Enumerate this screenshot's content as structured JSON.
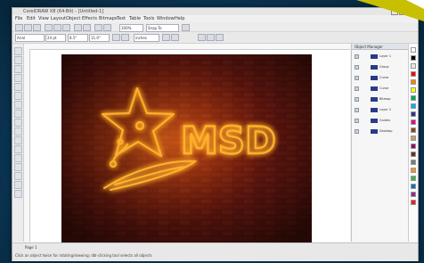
{
  "app": {
    "title": "CorelDRAW X8 (64-Bit) - [Untitled-1]",
    "menu": [
      "File",
      "Edit",
      "View",
      "Layout",
      "Object",
      "Effects",
      "Bitmaps",
      "Text",
      "Table",
      "Tools",
      "Window",
      "Help"
    ]
  },
  "toolbar": {
    "font_name": "Arial",
    "font_size": "24 pt",
    "zoom": "100%",
    "snap_to": "Snap To",
    "width_field": "8.5\"",
    "height_field": "11.0\"",
    "units": "inches"
  },
  "artwork": {
    "logo_text": "MSD",
    "description_colors": {
      "wall": "#8a1e16",
      "mortar": "#3b0805",
      "neon": "#ff9b12",
      "glow": "#ffcf66"
    }
  },
  "docker": {
    "title": "Object Manager",
    "layers": [
      {
        "label": "Layer 1"
      },
      {
        "label": "Group"
      },
      {
        "label": "Curve"
      },
      {
        "label": "Curve"
      },
      {
        "label": "Bitmap"
      },
      {
        "label": "Layer 2"
      },
      {
        "label": "Guides"
      },
      {
        "label": "Desktop"
      }
    ]
  },
  "palette": {
    "swatches": [
      "#ffffff",
      "#000000",
      "#e8e8e8",
      "#ff0000",
      "#ff7f00",
      "#ffff00",
      "#00a651",
      "#00aeef",
      "#2e3192",
      "#ec008c",
      "#8b4513",
      "#c69c6d",
      "#9e005d",
      "#603913",
      "#7a7a7a",
      "#f7941d",
      "#39b54a",
      "#0072bc",
      "#92278f",
      "#ed1c24"
    ]
  },
  "status": {
    "page": "Page 1",
    "info": "Click an object twice for rotating/skewing; dbl-clicking tool selects all objects"
  },
  "badge": {
    "color": "#c6c000"
  }
}
